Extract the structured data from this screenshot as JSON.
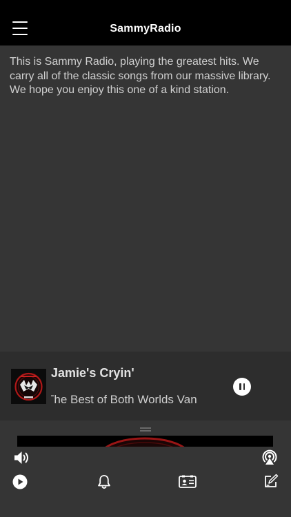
{
  "header": {
    "title": "SammyRadio",
    "menu_icon": "hamburger-menu-icon"
  },
  "station": {
    "description": "This is Sammy Radio, playing the greatest hits. We carry all of the classic songs from our massive library. We hope you enjoy this one of a kind station."
  },
  "now_playing": {
    "song_title": "Jamie's Cryin'",
    "artist_album": "The Best of Both Worlds Van",
    "album_art_icon": "album-art",
    "control_icon": "pause-icon"
  },
  "bottom_controls": {
    "volume_icon": "volume-icon",
    "airplay_icon": "airplay-icon"
  },
  "tab_bar": {
    "items": [
      {
        "icon": "play-circle-icon"
      },
      {
        "icon": "bell-icon"
      },
      {
        "icon": "contact-card-icon"
      },
      {
        "icon": "compose-icon"
      }
    ]
  },
  "colors": {
    "header_bg": "#000000",
    "page_bg": "#353535",
    "player_bg": "#2d2d2d",
    "text_primary": "#ffffff",
    "text_secondary": "#d0d0d0"
  }
}
